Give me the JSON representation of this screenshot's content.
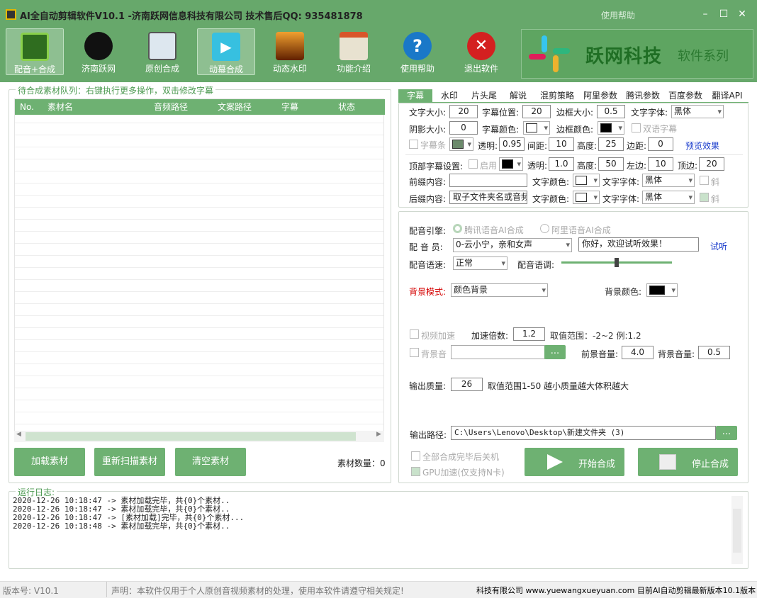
{
  "app": {
    "title": "AI全自动剪辑软件V10.1 -济南跃网信息科技有限公司 技术售后QQ: 935481878",
    "help": "使用帮助"
  },
  "toolbar": {
    "items": [
      {
        "label": "配音+合成",
        "icon": "clapperboard-icon",
        "active": true
      },
      {
        "label": "济南跃网",
        "icon": "film-reel-icon",
        "active": false
      },
      {
        "label": "原创合成",
        "icon": "picture-icon",
        "active": false
      },
      {
        "label": "动幕合成",
        "icon": "play-icon",
        "active": true
      },
      {
        "label": "动态水印",
        "icon": "sunset-icon",
        "active": false
      },
      {
        "label": "功能介绍",
        "icon": "home-icon",
        "active": false
      },
      {
        "label": "使用帮助",
        "icon": "help-icon",
        "active": false
      },
      {
        "label": "退出软件",
        "icon": "exit-icon",
        "active": false
      }
    ],
    "brand": "跃网科技",
    "brand_sub": "软件系列"
  },
  "queue": {
    "label": "待合成素材队列：右键执行更多操作，双击修改字幕",
    "columns": [
      "No.",
      "素材名",
      "音频路径",
      "文案路径",
      "字幕",
      "状态"
    ],
    "buttons": {
      "load": "加载素材",
      "rescan": "重新扫描素材",
      "clear": "清空素材"
    },
    "count_label": "素材数量：0"
  },
  "tabs": [
    "字幕",
    "水印",
    "片头尾",
    "解说",
    "混剪策略",
    "阿里参数",
    "腾讯参数",
    "百度参数",
    "翻译API"
  ],
  "subtitle": {
    "font_size_label": "文字大小:",
    "font_size": "20",
    "pos_label": "字幕位置:",
    "pos": "20",
    "border_label": "边框大小:",
    "border": "0.5",
    "font_label": "文字字体:",
    "font": "黑体",
    "shadow_label": "阴影大小:",
    "shadow": "0",
    "color_label": "字幕颜色:",
    "bcolor_label": "边框颜色:",
    "bilingual": "双语字幕",
    "bar_label": "字幕条",
    "alpha_label": "透明:",
    "alpha": "0.95",
    "gap_label": "间距:",
    "gap": "10",
    "height_label": "高度:",
    "height": "25",
    "margin_label": "边距:",
    "margin": "0",
    "preview": "预览效果",
    "top_label": "顶部字幕设置:",
    "enable": "启用",
    "alpha2": "1.0",
    "height2": "50",
    "left_label": "左边:",
    "left": "10",
    "top2_label": "顶边:",
    "top2": "20",
    "prefix_label": "前缀内容:",
    "prefix": "",
    "textcolor_label": "文字颜色:",
    "italic": "斜",
    "suffix_label": "后缀内容:",
    "suffix": "取子文件夹名或音频"
  },
  "voice": {
    "engine_label": "配音引擎:",
    "engine1": "腾讯语音AI合成",
    "engine2": "阿里语音AI合成",
    "actor_label": "配 音 员:",
    "actor": "0-云小宁，亲和女声",
    "sample": "你好，欢迎试听效果！",
    "try": "试听",
    "speed_label": "配音语速:",
    "speed": "正常",
    "tone_label": "配音语调:",
    "tone_level": 0.5,
    "bg_mode_label": "背景模式:",
    "bg_mode": "颜色背景",
    "bg_color_label": "背景颜色:",
    "accel_label": "视频加速",
    "accel_rate_label": "加速倍数:",
    "accel_rate": "1.2",
    "accel_range": "取值范围：-2~2 例:1.2",
    "bgm_label": "背景音",
    "fg_vol_label": "前景音量:",
    "fg_vol": "4.0",
    "bg_vol_label": "背景音量:",
    "bg_vol": "0.5",
    "browse": "...",
    "quality_label": "输出质量:",
    "quality": "26",
    "quality_hint": "取值范围1-50 越小质量越大体积越大",
    "out_label": "输出路径:",
    "out_path": "C:\\Users\\Lenovo\\Desktop\\新建文件夹 (3)",
    "shutdown": "全部合成完毕后关机",
    "gpu": "GPU加速(仅支持N卡)",
    "start": "开始合成",
    "stop": "停止合成"
  },
  "log": {
    "label": "运行日志:",
    "lines": [
      "2020-12-26 10:18:47 -> 素材加载完毕，共{0}个素材..",
      "2020-12-26 10:18:47 -> 素材加载完毕，共{0}个素材..",
      "2020-12-26 10:18:47 -> [素材加载]完毕，共{0}个素材...",
      "2020-12-26 10:18:48 -> 素材加载完毕，共{0}个素材.."
    ]
  },
  "status": {
    "version": "版本号: V10.1",
    "notice": "声明：本软件仅用于个人原创音视频素材的处理，使用本软件请遵守相关规定!",
    "marquee": "科技有限公司 www.yuewangxueyuan.com 目前AI自动剪辑最新版本10.1版本"
  }
}
